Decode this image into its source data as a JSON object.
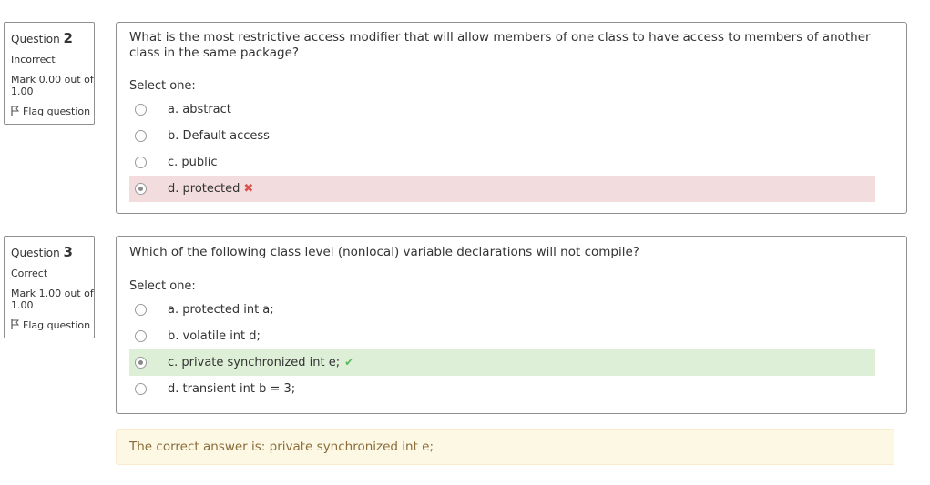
{
  "questions": [
    {
      "label": "Question",
      "number": "2",
      "state": "Incorrect",
      "grade": "Mark 0.00 out of 1.00",
      "flag": "Flag question",
      "text": "What is the most restrictive access modifier that will allow members of one class to have access to members of another class in the same package?",
      "prompt": "Select one:",
      "answers": [
        {
          "label": "a. abstract",
          "selected": false
        },
        {
          "label": "b. Default access",
          "selected": false
        },
        {
          "label": "c. public",
          "selected": false
        },
        {
          "label": "d. protected",
          "selected": true,
          "result": "incorrect",
          "mark": "✖"
        }
      ]
    },
    {
      "label": "Question",
      "number": "3",
      "state": "Correct",
      "grade": "Mark 1.00 out of 1.00",
      "flag": "Flag question",
      "text": "Which of the following class level (nonlocal) variable declarations will not compile?",
      "prompt": "Select one:",
      "answers": [
        {
          "label": "a. protected int a;",
          "selected": false
        },
        {
          "label": "b. volatile int d;",
          "selected": false
        },
        {
          "label": "c. private synchronized int e;",
          "selected": true,
          "result": "correct",
          "mark": "✔"
        },
        {
          "label": "d. transient int b = 3;",
          "selected": false
        }
      ]
    }
  ],
  "feedback": "The correct answer is: private synchronized int e;",
  "colors": {
    "incorrect_bg": "#f3dcdd",
    "correct_bg": "#deefd8",
    "feedback_bg": "#fcf8e3",
    "feedback_text": "#8a6d3b",
    "cross": "#d9534f",
    "check": "#5cb85c"
  },
  "icons": {
    "flag": "flag-icon",
    "radio": "radio-button"
  }
}
